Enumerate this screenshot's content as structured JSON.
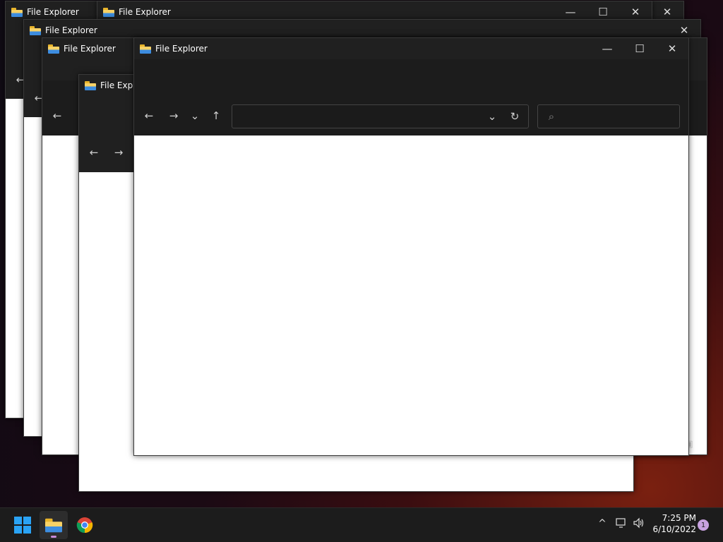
{
  "windows": {
    "title": "File Explorer",
    "title_truncated": "File Explo",
    "controls": {
      "minimize": "—",
      "maximize": "☐",
      "close": "✕"
    }
  },
  "navigation": {
    "back": "←",
    "forward": "→",
    "recent": "⌄",
    "up": "↑",
    "address_dropdown": "⌄",
    "refresh": "↻",
    "search_icon": "⌕"
  },
  "taskbar": {
    "apps": [
      {
        "name": "start",
        "icon": "windows-logo-icon"
      },
      {
        "name": "file-explorer",
        "icon": "folder-icon"
      },
      {
        "name": "chrome",
        "icon": "chrome-icon"
      }
    ],
    "tray": {
      "chevron": "^",
      "network": "network-icon",
      "volume": "speaker-icon"
    },
    "clock": {
      "time": "7:25 PM",
      "date": "6/10/2022"
    },
    "notification_count": "1"
  },
  "colors": {
    "titlebar": "#202020",
    "navbar": "#1c1c1c",
    "content": "#ffffff",
    "taskbar": "#1c1c1c",
    "badge": "#c8a2e0",
    "start_blue": "#2aa3f5"
  }
}
